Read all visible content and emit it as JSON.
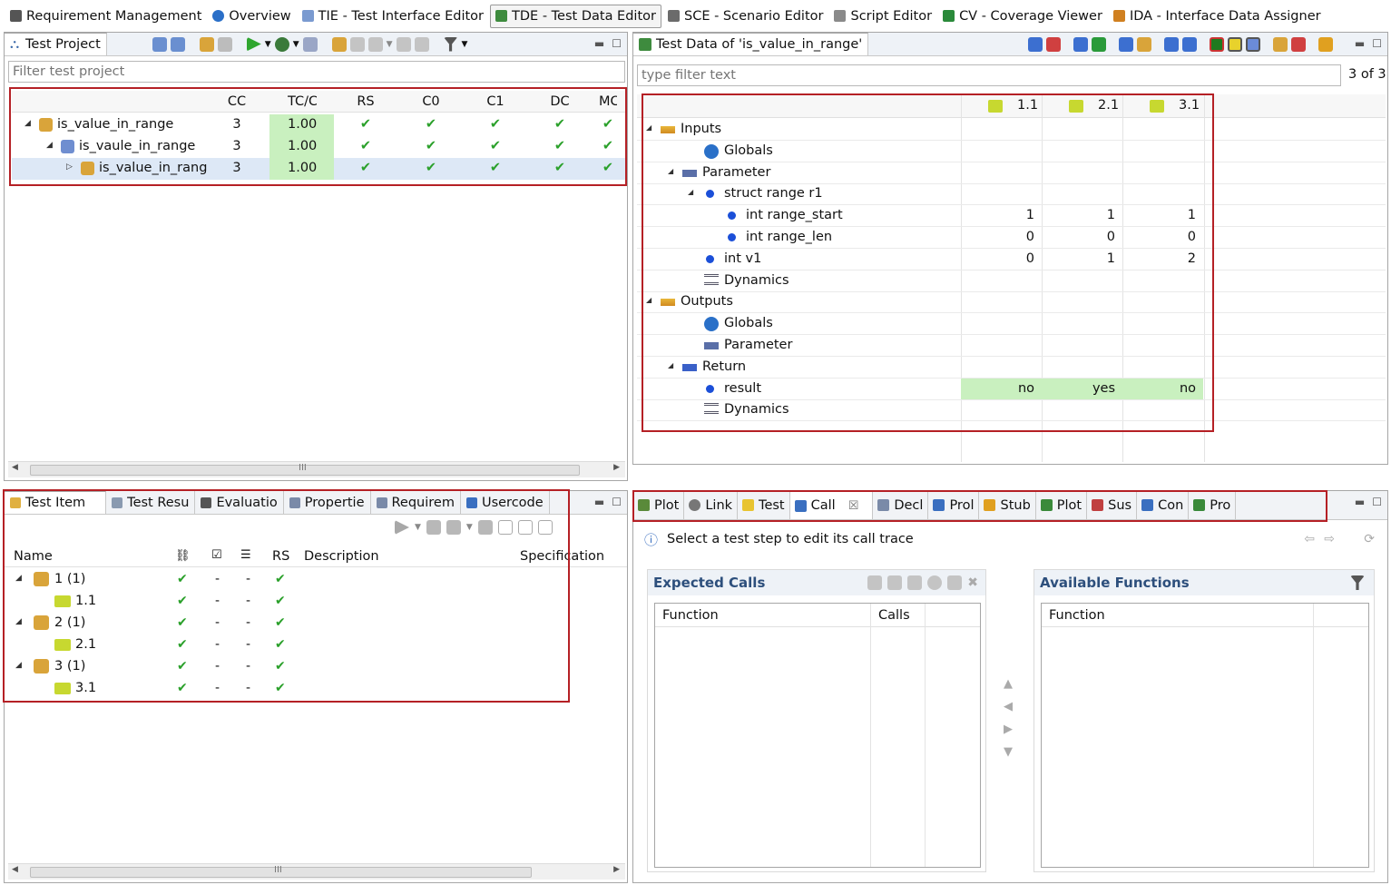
{
  "perspectives": [
    {
      "label": "Requirement Management",
      "icon": "document-icon",
      "active": false
    },
    {
      "label": "Overview",
      "icon": "globe-icon",
      "active": false
    },
    {
      "label": "TIE - Test Interface Editor",
      "icon": "tie-icon",
      "active": false
    },
    {
      "label": "TDE - Test Data Editor",
      "icon": "tde-icon",
      "active": true
    },
    {
      "label": "SCE - Scenario Editor",
      "icon": "sce-icon",
      "active": false
    },
    {
      "label": "Script Editor",
      "icon": "script-icon",
      "active": false
    },
    {
      "label": "CV - Coverage Viewer",
      "icon": "cv-icon",
      "active": false
    },
    {
      "label": "IDA - Interface Data Assigner",
      "icon": "ida-icon",
      "active": false
    }
  ],
  "project": {
    "tab": "Test Project",
    "filter_placeholder": "Filter test project",
    "columns": [
      "CC",
      "TC/C",
      "RS",
      "C0",
      "C1",
      "DC",
      "MC/"
    ],
    "rows": [
      {
        "name": "is_value_in_range",
        "cc": "3",
        "tcc": "1.00",
        "rs": "✔",
        "c0": "✔",
        "c1": "✔",
        "dc": "✔",
        "mc": "✔"
      },
      {
        "name": "is_vaule_in_range",
        "cc": "3",
        "tcc": "1.00",
        "rs": "✔",
        "c0": "✔",
        "c1": "✔",
        "dc": "✔",
        "mc": "✔"
      },
      {
        "name": "is_value_in_rang",
        "cc": "3",
        "tcc": "1.00",
        "rs": "✔",
        "c0": "✔",
        "c1": "✔",
        "dc": "✔",
        "mc": "✔"
      }
    ],
    "scroll_label": "III"
  },
  "testdata": {
    "tab": "Test Data of 'is_value_in_range'",
    "filter_placeholder": "type filter text",
    "count": "3 of 3",
    "columns": [
      "1.1",
      "2.1",
      "3.1"
    ],
    "rows": [
      {
        "label": "Inputs",
        "indent": 0,
        "expand": "◢",
        "icon": "inputs-icon",
        "v": [
          "",
          "",
          ""
        ]
      },
      {
        "label": "Globals",
        "indent": 2,
        "expand": "",
        "icon": "globals-icon",
        "v": [
          "",
          "",
          ""
        ]
      },
      {
        "label": "Parameter",
        "indent": 1,
        "expand": "◢",
        "icon": "parameter-icon",
        "v": [
          "",
          "",
          ""
        ]
      },
      {
        "label": "struct range r1",
        "indent": 2,
        "expand": "◢",
        "icon": "dot",
        "v": [
          "",
          "",
          ""
        ]
      },
      {
        "label": "int range_start",
        "indent": 3,
        "expand": "",
        "icon": "dot",
        "v": [
          "1",
          "1",
          "1"
        ]
      },
      {
        "label": "int range_len",
        "indent": 3,
        "expand": "",
        "icon": "dot",
        "v": [
          "0",
          "0",
          "0"
        ]
      },
      {
        "label": "int v1",
        "indent": 2,
        "expand": "",
        "icon": "dot",
        "v": [
          "0",
          "1",
          "2"
        ]
      },
      {
        "label": "Dynamics",
        "indent": 2,
        "expand": "",
        "icon": "dynamics-icon",
        "v": [
          "",
          "",
          ""
        ]
      },
      {
        "label": "Outputs",
        "indent": 0,
        "expand": "◢",
        "icon": "outputs-icon",
        "v": [
          "",
          "",
          ""
        ]
      },
      {
        "label": "Globals",
        "indent": 2,
        "expand": "",
        "icon": "globals-icon",
        "v": [
          "",
          "",
          ""
        ]
      },
      {
        "label": "Parameter",
        "indent": 2,
        "expand": "",
        "icon": "parameter-icon",
        "v": [
          "",
          "",
          ""
        ]
      },
      {
        "label": "Return",
        "indent": 1,
        "expand": "◢",
        "icon": "return-icon",
        "v": [
          "",
          "",
          ""
        ]
      },
      {
        "label": "result",
        "indent": 2,
        "expand": "",
        "icon": "dot",
        "v": [
          "no",
          "yes",
          "no"
        ]
      },
      {
        "label": "Dynamics",
        "indent": 2,
        "expand": "",
        "icon": "dynamics-icon",
        "v": [
          "",
          "",
          ""
        ]
      }
    ]
  },
  "items": {
    "tabs": [
      "Test Item",
      "Test Resu",
      "Evaluatio",
      "Propertie",
      "Requirem",
      "Usercode"
    ],
    "columns": [
      "Name",
      "RS",
      "Description",
      "Specification"
    ],
    "rows": [
      {
        "name": "1 (1)",
        "level": 0,
        "a": "✔",
        "b": "-",
        "c": "-",
        "rs": "✔"
      },
      {
        "name": "1.1",
        "level": 1,
        "a": "✔",
        "b": "-",
        "c": "-",
        "rs": "✔"
      },
      {
        "name": "2 (1)",
        "level": 0,
        "a": "✔",
        "b": "-",
        "c": "-",
        "rs": "✔"
      },
      {
        "name": "2.1",
        "level": 1,
        "a": "✔",
        "b": "-",
        "c": "-",
        "rs": "✔"
      },
      {
        "name": "3 (1)",
        "level": 0,
        "a": "✔",
        "b": "-",
        "c": "-",
        "rs": "✔"
      },
      {
        "name": "3.1",
        "level": 1,
        "a": "✔",
        "b": "-",
        "c": "-",
        "rs": "✔"
      }
    ],
    "scroll_label": "III"
  },
  "calltrace": {
    "tabs": [
      "Plot",
      "Link",
      "Test",
      "Call",
      "Decl",
      "Prol",
      "Stub",
      "Plot",
      "Sus",
      "Con",
      "Pro"
    ],
    "close_glyph": "☒",
    "info": "Select a test step to edit its call trace",
    "expected_title": "Expected Calls",
    "expected_cols": [
      "Function",
      "Calls"
    ],
    "available_title": "Available Functions",
    "available_cols": [
      "Function"
    ]
  }
}
